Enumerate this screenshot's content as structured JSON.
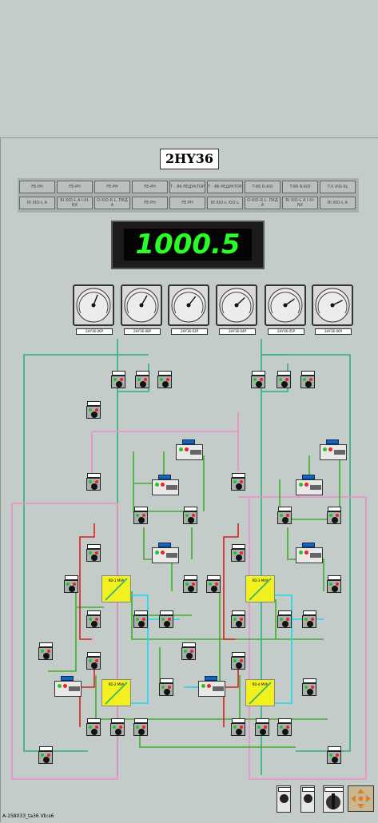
{
  "panel": {
    "title": "2HY36",
    "display_value": "1000.5",
    "footer_label": "A-1S8033_ta36 Vb:s6"
  },
  "colors": {
    "background": "#c3ccc8",
    "display_digits": "#27ff27",
    "pipe_green": "#2ab37a",
    "pipe_lime": "#3cb028",
    "pipe_pink": "#f08cc8",
    "pipe_cyan": "#19d8f0",
    "pipe_red": "#e01c1c",
    "valve_yellow": "#f3f01f"
  },
  "annunciators": {
    "row1": [
      "FE-PH",
      "FE-PH",
      "FE-PH",
      "FE-PH",
      "T - 86 РЕДУКТОР",
      "T - 86 РЕДУКТОР",
      "T-86 R-XIO",
      "T-86 R-XIO",
      "T-X XIO-XL"
    ],
    "row2": [
      "RI XIO-L A",
      "RI XIO-L A I-XI-NX",
      "O-XIO-R L. ПКД A",
      "FE-PH",
      "FE-PH",
      "RI XIO-L XIO-L",
      "O-XIO-R L. ПКД A",
      "RI XIO-L A I-XI-NX",
      "RI XIO-L A"
    ]
  },
  "gauges": [
    {
      "tag": "2HY36-06P"
    },
    {
      "tag": "2HY36-08P"
    },
    {
      "tag": "2HY36-03P"
    },
    {
      "tag": "2HY36-04P"
    },
    {
      "tag": "2HY36-05P"
    },
    {
      "tag": "2HY36-06P"
    }
  ],
  "valves": {
    "yellow_labels": [
      "RD-1 MVA",
      "RD-2 MVA",
      "RD-3 MVA",
      "RD-4 MVA"
    ]
  },
  "icons": {
    "switch": "two-position-selector-icon",
    "nav": "four-way-arrow-icon",
    "key": "key-switch-icon"
  }
}
